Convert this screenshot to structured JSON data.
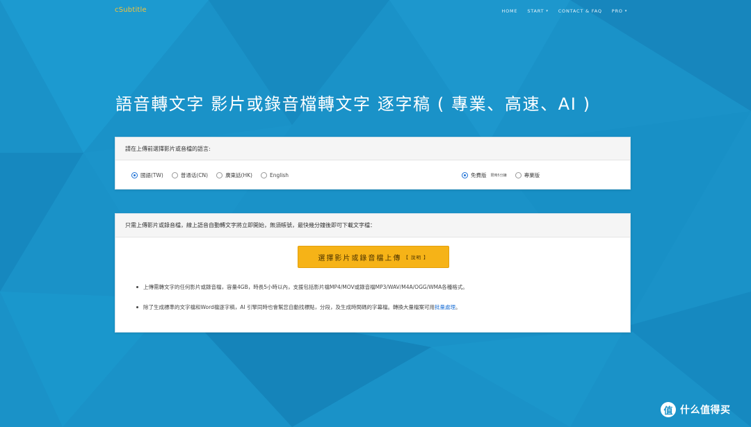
{
  "nav": {
    "brand": "cSubtitle",
    "links": [
      {
        "label": "HOME",
        "has_caret": false
      },
      {
        "label": "START",
        "has_caret": true
      },
      {
        "label": "CONTACT & FAQ",
        "has_caret": false
      },
      {
        "label": "PRO",
        "has_caret": true
      }
    ],
    "caret": "▾"
  },
  "hero": {
    "title": "語音轉文字 影片或錄音檔轉文字 逐字稿 ( 專業、高速、AI )"
  },
  "language_card": {
    "header": "請在上傳前選擇影片或音檔的語言:",
    "languages": [
      {
        "label": "國語(TW)",
        "selected": true
      },
      {
        "label": "普通话(CN)",
        "selected": false
      },
      {
        "label": "廣東話(HK)",
        "selected": false
      },
      {
        "label": "English",
        "selected": false
      }
    ],
    "plans": [
      {
        "label": "免費版",
        "tag": "限時5分鐘",
        "selected": true
      },
      {
        "label": "專業版",
        "tag": "",
        "selected": false
      }
    ]
  },
  "upload_card": {
    "header": "只需上傳影片或錄音檔，線上語音自動轉文字將立即開始，無須帳號，最快幾分鐘後即可下載文字檔：",
    "button_label": "選擇影片或錄音檔上傳",
    "button_note": "【 說明 】",
    "info": [
      {
        "text": "上傳需轉文字的任何影片或錄音檔，容量4GB，時長5小時以內，支援包括影片檔MP4/MOV或錄音檔MP3/WAV/M4A/OGG/WMA各種格式。",
        "link": ""
      },
      {
        "text": "除了生成標準的文字檔和Word檔逐字稿，AI 引擎同時也會幫您自動找標點，分段，及生成時間碼的字幕檔。轉換大量檔案可用",
        "link": "批量處理",
        "suffix": "。"
      }
    ]
  },
  "watermark": {
    "icon": "值",
    "text": "什么值得买"
  },
  "colors": {
    "background": "#1a92c8",
    "brand": "#f3c33b",
    "button": "#f6b317",
    "link": "#1f72d6"
  }
}
